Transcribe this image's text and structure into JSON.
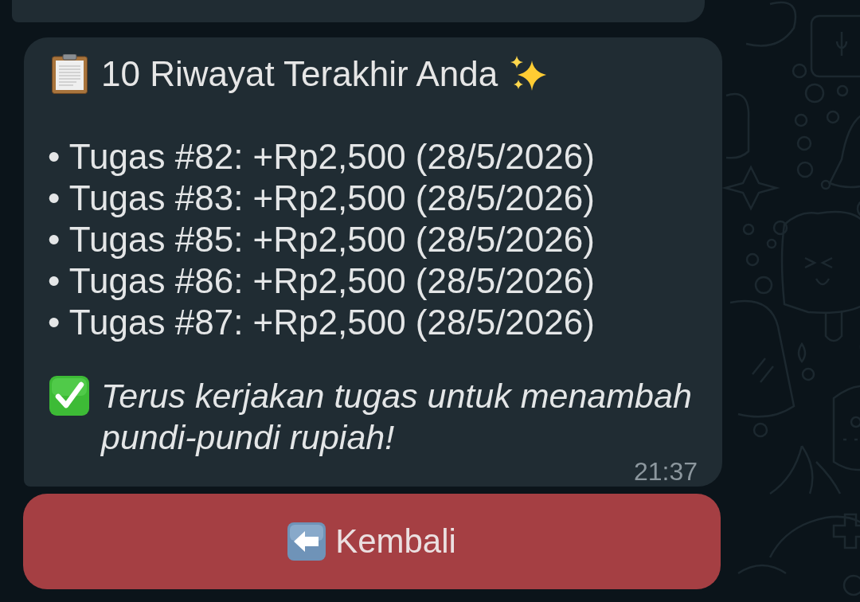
{
  "message": {
    "title": "10 Riwayat Terakhir Anda",
    "lines": [
      "• Tugas #82: +Rp2,500 (28/5/2026)",
      "• Tugas #83: +Rp2,500 (28/5/2026)",
      "• Tugas #85: +Rp2,500 (28/5/2026)",
      "• Tugas #86: +Rp2,500 (28/5/2026)",
      "• Tugas #87: +Rp2,500 (28/5/2026)"
    ],
    "note": "Terus kerjakan tugas untuk menambah pundi-pundi rupiah!",
    "time": "21:37"
  },
  "button": {
    "label": "Kembali"
  }
}
